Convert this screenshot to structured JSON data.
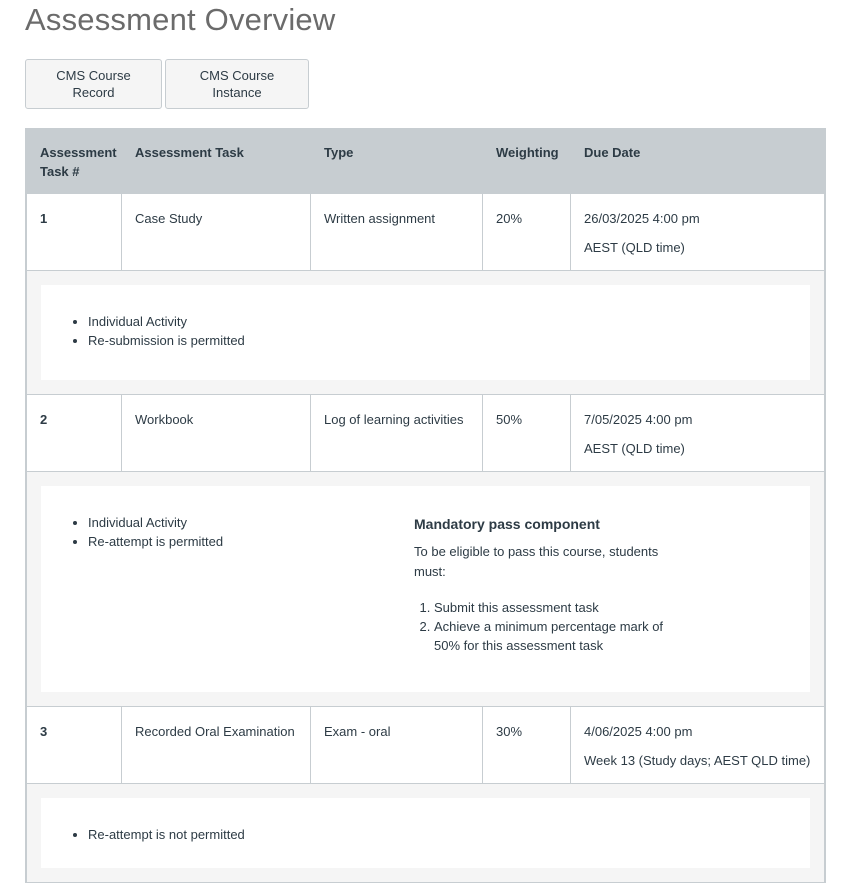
{
  "page": {
    "title": "Assessment Overview"
  },
  "buttons": [
    {
      "label_line1": "CMS Course",
      "label_line2": "Record"
    },
    {
      "label_line1": "CMS Course",
      "label_line2": "Instance"
    }
  ],
  "table": {
    "headers": [
      "Assessment Task #",
      "Assessment Task",
      "Type",
      "Weighting",
      "Due Date"
    ],
    "header_bg": "#c7cdd1",
    "rows": [
      {
        "num": "1",
        "task": "Case Study",
        "type": "Written assignment",
        "weighting": "20%",
        "due_line1": "26/03/2025 4:00 pm",
        "due_line2": "AEST (QLD time)",
        "notes": [
          "Individual Activity",
          "Re-submission is permitted"
        ]
      },
      {
        "num": "2",
        "task": "Workbook",
        "type": "Log of learning activities",
        "weighting": "50%",
        "due_line1": "7/05/2025 4:00 pm",
        "due_line2": "AEST (QLD time)",
        "notes": [
          "Individual Activity",
          "Re-attempt is permitted"
        ],
        "mandatory": {
          "title": "Mandatory pass component",
          "text": "To be eligible to pass this course, students must:",
          "items": [
            "Submit this assessment task",
            "Achieve a minimum percentage mark of 50% for this assessment task"
          ]
        }
      },
      {
        "num": "3",
        "task": "Recorded Oral Examination",
        "type": "Exam - oral",
        "weighting": "30%",
        "due_line1": "4/06/2025 4:00 pm",
        "due_line2": "Week 13 (Study days; AEST QLD time)",
        "notes": [
          "Re-attempt is not permitted"
        ]
      }
    ]
  }
}
